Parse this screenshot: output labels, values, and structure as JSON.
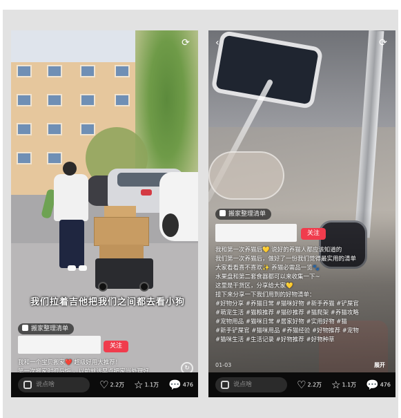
{
  "left": {
    "video_caption": "我们拉着吉他把我们之间都去看小狗",
    "tag_label": "搬家整理清单",
    "follow_label": "关注",
    "description_lines": [
      "我和一个宝贝搬家❤️  超级好用大推荐！",
      "第一次搬家时很后悔 ，以前就该早点把家当处理好"
    ],
    "comment_placeholder": "说点啥",
    "likes": "2.2万",
    "favorites": "1.1万",
    "comments": "476",
    "progress_fraction": 0.03
  },
  "right": {
    "tag_label": "搬家整理清单",
    "follow_label": "关注",
    "description_lines": [
      "我和第一次养猫后💛  说好的养猫人都应该知道的",
      "我们第一次养猫后，做好了一份我们觉得最实用的清单",
      "大家看看喜不喜欢✨  养猫必需品一览🐾",
      "水果盘和第二套食器都可以来收集一下~",
      "这里是干货区，分享给大家💛",
      "接下来分享一下我们用到的好物清单：",
      "#好物分享  #养猫日常  #猫咪好物  #新手养猫  #铲屎官",
      "#萌宠生活  #猫粮推荐  #猫砂推荐  #猫爬架  #养猫攻略",
      "#宠物用品  #猫咪日常  #居家好物  #实用好物  #猫",
      "#新手铲屎官  #猫咪用品  #养猫经验  #好物推荐  #宠物",
      "#猫咪生活  #生活记录  #好物推荐  #好物种草"
    ],
    "time_label": "01-03",
    "more_label": "展开",
    "comment_placeholder": "说点啥",
    "likes": "2.2万",
    "favorites": "1.1万",
    "comments": "476"
  },
  "icons": {
    "like": "heart-icon",
    "favorite": "star-icon",
    "comment": "comment-icon",
    "share": "share-icon",
    "rotate": "rotate-icon"
  },
  "colors": {
    "follow_button": "#f03c4d",
    "panel_background": "#e2e2e2",
    "bottom_bar": "#0b0b0b"
  }
}
